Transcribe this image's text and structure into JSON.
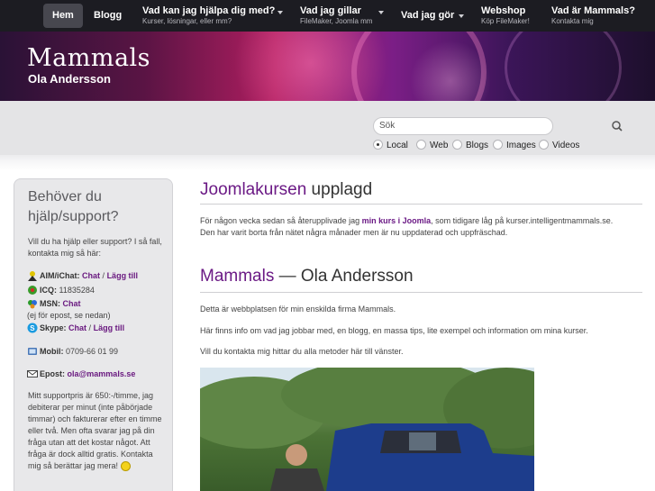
{
  "nav": {
    "home": "Hem",
    "blog": "Blogg",
    "help": {
      "title": "Vad kan jag hjälpa dig med?",
      "sub": "Kurser, lösningar, eller mm?"
    },
    "likes": {
      "title": "Vad jag gillar",
      "sub": "FileMaker, Joomla mm"
    },
    "does": {
      "title": "Vad jag gör"
    },
    "shop": {
      "title": "Webshop",
      "sub": "Köp FileMaker!"
    },
    "about": {
      "title": "Vad är Mammals?",
      "sub": "Kontakta mig"
    }
  },
  "header": {
    "title": "Mammals",
    "subtitle": "Ola Andersson"
  },
  "search": {
    "placeholder": "Sök",
    "options": [
      "Local",
      "Web",
      "Blogs",
      "Images",
      "Videos"
    ],
    "selected": "Local"
  },
  "sidebar": {
    "title": "Behöver du hjälp/support?",
    "intro": "Vill du ha hjälp eller support? I så fall, kontakta mig så här:",
    "aim_label": "AIM/iChat:",
    "aim_chat": "Chat",
    "aim_sep": "/",
    "aim_add": "Lägg till",
    "icq_label": "ICQ:",
    "icq_value": "11835284",
    "msn_label": "MSN:",
    "msn_chat": "Chat",
    "msn_note": "(ej för epost, se nedan)",
    "skype_label": "Skype:",
    "skype_chat": "Chat",
    "skype_sep": "/",
    "skype_add": "Lägg till",
    "mobile_label": "Mobil:",
    "mobile_value": "0709-66 01 99",
    "email_label": "Epost:",
    "email_value": "ola@mammals.se",
    "pricing": "Mitt supportpris är 650:-/timme, jag debiterar per minut (inte påbörjade timmar) och fakturerar efter en timme eller två. Men ofta svarar jag på din fråga utan att det kostar något. Att fråga är dock alltid gratis. Kontakta mig så berättar jag mera!"
  },
  "post1": {
    "title_accent": "Joomlakursen",
    "title_rest": " upplagd",
    "text_before": "För någon vecka sedan så återupplivade jag ",
    "link": "min kurs i Joomla",
    "text_after": ", som tidigare låg på kurser.intelligentmammals.se. Den har varit borta från nätet några månader men är nu uppdaterad och uppfräschad."
  },
  "post2": {
    "title_accent": "Mammals",
    "title_rest": " — Ola Andersson",
    "p1": "Detta är webbplatsen för min enskilda firma Mammals.",
    "p2": "Här finns info om vad jag jobbar med, en blogg, en massa tips, lite exempel och information om mina kurser.",
    "p3": "Vill du kontakta mig hittar du alla metoder här till vänster."
  },
  "colors": {
    "accent": "#6b1a85",
    "nav_bg": "#1c1c22"
  }
}
